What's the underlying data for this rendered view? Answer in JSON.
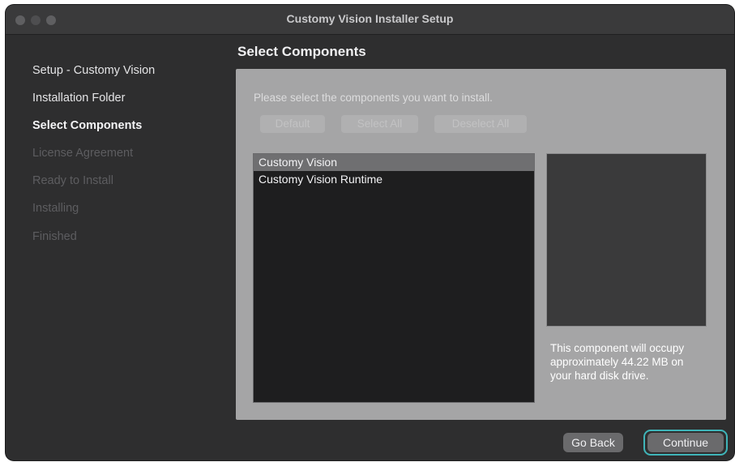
{
  "window": {
    "title": "Customy Vision Installer Setup"
  },
  "sidebar": {
    "items": [
      {
        "label": "Setup - Customy Vision",
        "state": "done"
      },
      {
        "label": "Installation Folder",
        "state": "done"
      },
      {
        "label": "Select Components",
        "state": "active"
      },
      {
        "label": "License Agreement",
        "state": "pending"
      },
      {
        "label": "Ready to Install",
        "state": "pending"
      },
      {
        "label": "Installing",
        "state": "pending"
      },
      {
        "label": "Finished",
        "state": "pending"
      }
    ]
  },
  "main": {
    "title": "Select Components",
    "instructions": "Please select the components you want to install.",
    "buttons": {
      "default": "Default",
      "select_all": "Select All",
      "deselect_all": "Deselect All"
    },
    "components": [
      {
        "label": "Customy Vision",
        "selected": true
      },
      {
        "label": "Customy Vision Runtime",
        "selected": false
      }
    ],
    "description": "This component will occupy approximately 44.22 MB on your hard disk drive."
  },
  "footer": {
    "go_back": "Go Back",
    "continue": "Continue"
  },
  "colors": {
    "accent_focus_ring": "#3fb5b9",
    "window_bg": "#2e2e2f",
    "panel_bg": "#a5a5a6"
  }
}
